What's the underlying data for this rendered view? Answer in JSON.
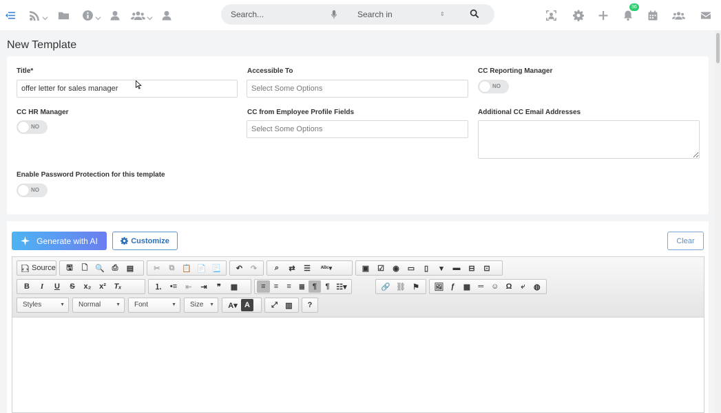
{
  "nav": {
    "notification_count": "36"
  },
  "search": {
    "placeholder": "Search...",
    "scope_label": "Search in"
  },
  "page": {
    "title": "New Template"
  },
  "form": {
    "title_label": "Title*",
    "title_value": "offer letter for sales manager",
    "accessible_label": "Accessible To",
    "accessible_placeholder": "Select Some Options",
    "cc_reporting_label": "CC Reporting Manager",
    "cc_hr_label": "CC HR Manager",
    "cc_profile_label": "CC from Employee Profile Fields",
    "cc_profile_placeholder": "Select Some Options",
    "additional_cc_label": "Additional CC Email Addresses",
    "password_label": "Enable Password Protection for this template",
    "toggle_off_text": "NO"
  },
  "actions": {
    "generate_ai": "Generate with AI",
    "customize": "Customize",
    "clear": "Clear"
  },
  "editor": {
    "source_label": "Source",
    "styles_label": "Styles",
    "format_label": "Normal",
    "font_label": "Font",
    "size_label": "Size"
  }
}
